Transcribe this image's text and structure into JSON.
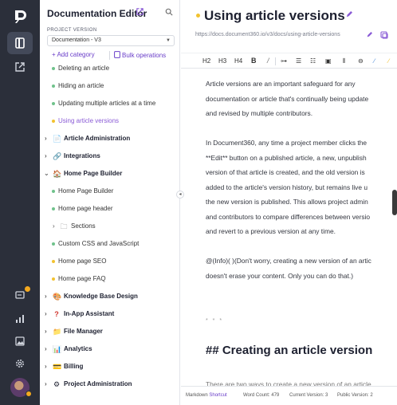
{
  "sidebar": {
    "title": "Documentation Editor",
    "project_version_label": "PROJECT VERSION",
    "project_version_value": "Documentation - V3",
    "add_category": "+ Add category",
    "bulk_operations": "Bulk operations",
    "items": [
      {
        "label": "Deleting an article",
        "kind": "article",
        "bullet": "green"
      },
      {
        "label": "Hiding an article",
        "kind": "article",
        "bullet": "green"
      },
      {
        "label": "Updating multiple articles at a time",
        "kind": "article",
        "bullet": "green"
      },
      {
        "label": "Using article versions",
        "kind": "article",
        "bullet": "yellow",
        "active": true
      },
      {
        "label": "Article Administration",
        "kind": "category",
        "icon": "document-icon"
      },
      {
        "label": "Integrations",
        "kind": "category",
        "icon": "link-icon"
      },
      {
        "label": "Home Page Builder",
        "kind": "category",
        "icon": "house-icon",
        "expanded": true
      },
      {
        "label": "Home Page Builder",
        "kind": "article",
        "bullet": "green"
      },
      {
        "label": "Home page header",
        "kind": "article",
        "bullet": "green"
      },
      {
        "label": "Sections",
        "kind": "folder",
        "icon": "folder-icon"
      },
      {
        "label": "Custom CSS and JavaScript",
        "kind": "article",
        "bullet": "green"
      },
      {
        "label": "Home page SEO",
        "kind": "article",
        "bullet": "yellow"
      },
      {
        "label": "Home page FAQ",
        "kind": "article",
        "bullet": "yellow"
      },
      {
        "label": "Knowledge Base Design",
        "kind": "category",
        "icon": "palette-icon"
      },
      {
        "label": "In-App Assistant",
        "kind": "category",
        "icon": "question-icon"
      },
      {
        "label": "File Manager",
        "kind": "category",
        "icon": "folder-icon"
      },
      {
        "label": "Analytics",
        "kind": "category",
        "icon": "chart-icon"
      },
      {
        "label": "Billing",
        "kind": "category",
        "icon": "card-icon"
      },
      {
        "label": "Project Administration",
        "kind": "category",
        "icon": "gear-icon"
      }
    ]
  },
  "article": {
    "title": "Using article versions",
    "url": "https://docs.document360.io/v3/docs/using-article-versions"
  },
  "toolbar": {
    "h2": "H2",
    "h3": "H3",
    "h4": "H4",
    "bold": "B",
    "italic": "/"
  },
  "editor": {
    "p1": [
      "Article versions are an important safeguard for any",
      "documentation or article that's continually being update",
      "and revised by multiple contributors."
    ],
    "p2": [
      "In Document360, any time a project member clicks the",
      "**Edit** button on a published article, a new, unpublish",
      "version of that article is created, and the old version is",
      "added to the article's version history, but remains live u",
      "the new version is published. This allows project admin",
      "and contributors to compare differences between versio",
      "and revert to a previous version at any time."
    ],
    "p3": [
      "@(Info)( )(Don't worry, creating a new version of an artic",
      "doesn't erase your content. Only you can do that.)"
    ],
    "hr": "* * *",
    "heading": "## Creating an article version",
    "cut_line": "There are two ways to create a new version of an article"
  },
  "statusbar": {
    "mode": "Markdown",
    "shortcut": "Shortcut",
    "word_count": "Word Count: 479",
    "current_version": "Current Version: 3",
    "public_version": "Public Version: 2"
  },
  "colors": {
    "rail": "#2b2f3a",
    "accent": "#6a3ec9",
    "published_dot": "#6fc28b",
    "draft_dot": "#f2c230"
  }
}
